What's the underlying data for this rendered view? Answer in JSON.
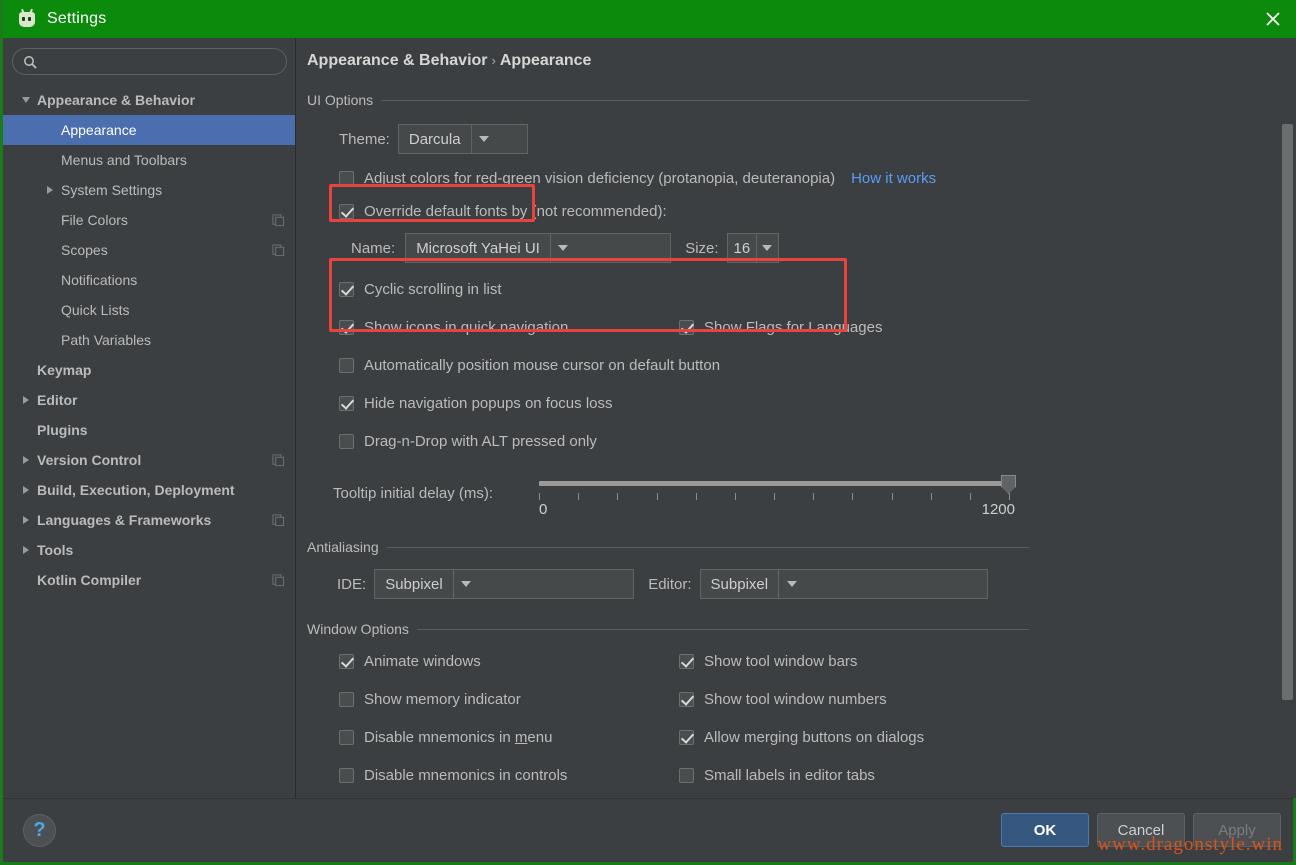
{
  "window": {
    "title": "Settings",
    "app_icon": "intellij-logo-icon",
    "close_label": "×",
    "title_bar_color": "#0b8a0b"
  },
  "search": {
    "value": "",
    "placeholder": ""
  },
  "sidebar": {
    "items": [
      {
        "label": "Appearance & Behavior",
        "level": 0,
        "twisty": "down",
        "bold": true,
        "selected": false,
        "copy_icon": false
      },
      {
        "label": "Appearance",
        "level": 1,
        "twisty": "none",
        "bold": false,
        "selected": true,
        "copy_icon": false
      },
      {
        "label": "Menus and Toolbars",
        "level": 1,
        "twisty": "none",
        "bold": false,
        "selected": false,
        "copy_icon": false
      },
      {
        "label": "System Settings",
        "level": 1,
        "twisty": "right",
        "bold": false,
        "selected": false,
        "copy_icon": false
      },
      {
        "label": "File Colors",
        "level": 1,
        "twisty": "none",
        "bold": false,
        "selected": false,
        "copy_icon": true
      },
      {
        "label": "Scopes",
        "level": 1,
        "twisty": "none",
        "bold": false,
        "selected": false,
        "copy_icon": true
      },
      {
        "label": "Notifications",
        "level": 1,
        "twisty": "none",
        "bold": false,
        "selected": false,
        "copy_icon": false
      },
      {
        "label": "Quick Lists",
        "level": 1,
        "twisty": "none",
        "bold": false,
        "selected": false,
        "copy_icon": false
      },
      {
        "label": "Path Variables",
        "level": 1,
        "twisty": "none",
        "bold": false,
        "selected": false,
        "copy_icon": false
      },
      {
        "label": "Keymap",
        "level": 0,
        "twisty": "none",
        "bold": true,
        "selected": false,
        "copy_icon": false
      },
      {
        "label": "Editor",
        "level": 0,
        "twisty": "right",
        "bold": true,
        "selected": false,
        "copy_icon": false
      },
      {
        "label": "Plugins",
        "level": 0,
        "twisty": "none",
        "bold": true,
        "selected": false,
        "copy_icon": false
      },
      {
        "label": "Version Control",
        "level": 0,
        "twisty": "right",
        "bold": true,
        "selected": false,
        "copy_icon": true
      },
      {
        "label": "Build, Execution, Deployment",
        "level": 0,
        "twisty": "right",
        "bold": true,
        "selected": false,
        "copy_icon": false
      },
      {
        "label": "Languages & Frameworks",
        "level": 0,
        "twisty": "right",
        "bold": true,
        "selected": false,
        "copy_icon": true
      },
      {
        "label": "Tools",
        "level": 0,
        "twisty": "right",
        "bold": true,
        "selected": false,
        "copy_icon": false
      },
      {
        "label": "Kotlin Compiler",
        "level": 0,
        "twisty": "none",
        "bold": true,
        "selected": false,
        "copy_icon": true
      }
    ]
  },
  "breadcrumb": {
    "parent": "Appearance & Behavior",
    "separator": "›",
    "current": "Appearance"
  },
  "ui_options": {
    "group_title": "UI Options",
    "theme_label": "Theme:",
    "theme_value": "Darcula",
    "adjust_colors_label": "Adjust colors for red-green vision deficiency (protanopia, deuteranopia)",
    "adjust_colors_checked": false,
    "how_it_works_link": "How it works",
    "override_fonts_label": "Override default fonts by (not recommended):",
    "override_fonts_checked": true,
    "font_name_label": "Name:",
    "font_name_value": "Microsoft YaHei UI",
    "font_size_label": "Size:",
    "font_size_value": "16",
    "checkboxes": [
      {
        "label": "Cyclic scrolling in list",
        "checked": true,
        "column": "left"
      },
      {
        "label": "Show icons in quick navigation",
        "checked": true,
        "column": "left"
      },
      {
        "label": "Show Flags for Languages",
        "checked": true,
        "column": "right"
      },
      {
        "label": "Automatically position mouse cursor on default button",
        "checked": false,
        "column": "left"
      },
      {
        "label": "Hide navigation popups on focus loss",
        "checked": true,
        "column": "left"
      },
      {
        "label": "Drag-n-Drop with ALT pressed only",
        "checked": false,
        "column": "left"
      }
    ],
    "tooltip_delay_label": "Tooltip initial delay (ms):",
    "tooltip_min": "0",
    "tooltip_max": "1200",
    "tooltip_value": 1200,
    "tooltip_tick_count": 13
  },
  "antialiasing": {
    "group_title": "Antialiasing",
    "ide_label": "IDE:",
    "ide_value": "Subpixel",
    "editor_label": "Editor:",
    "editor_value": "Subpixel"
  },
  "window_options": {
    "group_title": "Window Options",
    "left": [
      {
        "label": "Animate windows",
        "checked": true
      },
      {
        "label": "Show memory indicator",
        "checked": false
      },
      {
        "label": "Disable mnemonics in menu",
        "checked": false,
        "mnemonic": "m"
      },
      {
        "label": "Disable mnemonics in controls",
        "checked": false
      }
    ],
    "right": [
      {
        "label": "Show tool window bars",
        "checked": true
      },
      {
        "label": "Show tool window numbers",
        "checked": true
      },
      {
        "label": "Allow merging buttons on dialogs",
        "checked": true
      },
      {
        "label": "Small labels in editor tabs",
        "checked": false
      }
    ]
  },
  "footer": {
    "help_label": "?",
    "ok_label": "OK",
    "cancel_label": "Cancel",
    "apply_label": "Apply",
    "apply_disabled": true
  },
  "watermark": "www.dragonstyle.win",
  "annotations": {
    "color": "#e8433c"
  }
}
